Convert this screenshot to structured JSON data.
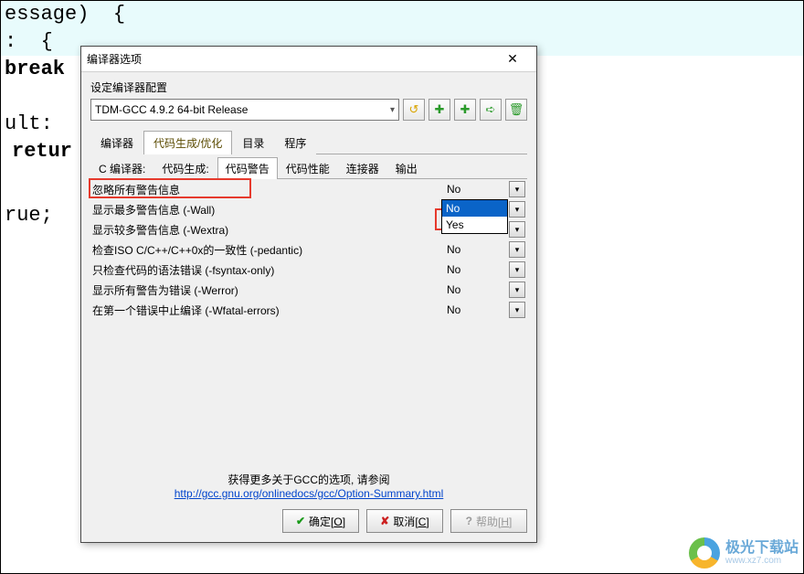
{
  "background_code": {
    "line1_frag": "essage)  {",
    "line2": ":  {",
    "line3": "break",
    "line5": "ult:",
    "line6": "retur",
    "line8": "rue;"
  },
  "dialog": {
    "title": "编译器选项",
    "config_label": "设定编译器配置",
    "config_value": "TDM-GCC 4.9.2 64-bit Release",
    "tabs": [
      "编译器",
      "代码生成/优化",
      "目录",
      "程序"
    ],
    "active_tab": 1,
    "subtabs": [
      "C 编译器:",
      "代码生成:",
      "代码警告",
      "代码性能",
      "连接器",
      "输出"
    ],
    "active_subtab": 2,
    "options": [
      {
        "label": "忽略所有警告信息",
        "value": "No"
      },
      {
        "label": "显示最多警告信息 (-Wall)",
        "value": "No"
      },
      {
        "label": "显示较多警告信息 (-Wextra)",
        "value": "No"
      },
      {
        "label": "检查ISO C/C++/C++0x的一致性 (-pedantic)",
        "value": "No"
      },
      {
        "label": "只检查代码的语法错误 (-fsyntax-only)",
        "value": "No"
      },
      {
        "label": "显示所有警告为错误 (-Werror)",
        "value": "No"
      },
      {
        "label": "在第一个错误中止编译 (-Wfatal-errors)",
        "value": "No"
      }
    ],
    "dropdown": {
      "items": [
        "No",
        "Yes"
      ],
      "selected_index": 0
    },
    "footer_text": "获得更多关于GCC的选项, 请参阅",
    "footer_link": "http://gcc.gnu.org/onlinedocs/gcc/Option-Summary.html",
    "buttons": {
      "ok_pre": "确定[",
      "ok_u": "O",
      "ok_post": "]",
      "cancel_pre": "取消[",
      "cancel_u": "C",
      "cancel_post": "]",
      "help_pre": "帮助[",
      "help_u": "H",
      "help_post": "]"
    }
  },
  "watermark": {
    "name": "极光下载站",
    "url": "www.xz7.com"
  }
}
